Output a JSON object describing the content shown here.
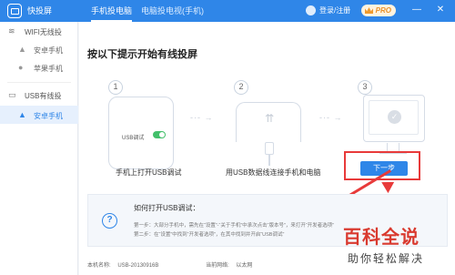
{
  "app": {
    "title": "快投屏"
  },
  "tabs": [
    {
      "label": "手机投电脑",
      "active": true
    },
    {
      "label": "电脑投电视(手机)",
      "active": false
    }
  ],
  "header": {
    "login_label": "登录/注册",
    "pro_label": "PRO",
    "minimize": "—",
    "close": "✕"
  },
  "sidebar": {
    "sections": [
      {
        "label": "WIFI无线投",
        "icon": "wifi-icon",
        "items": [
          {
            "label": "安卓手机",
            "icon": "android-icon"
          },
          {
            "label": "苹果手机",
            "icon": "apple-icon"
          }
        ]
      },
      {
        "label": "USB有线投",
        "icon": "usb-device-icon",
        "items": [
          {
            "label": "安卓手机",
            "icon": "android-icon",
            "active": true
          }
        ]
      }
    ]
  },
  "main": {
    "heading": "按以下提示开始有线投屏",
    "steps": [
      {
        "num": "1",
        "desc": "手机上打开USB调试",
        "toggle_label": "USB调试"
      },
      {
        "num": "2",
        "desc": "用USB数据线连接手机和电脑"
      },
      {
        "num": "3",
        "desc": ""
      }
    ],
    "arrow": "-·- →",
    "next_label": "下一步"
  },
  "help": {
    "title": "如何打开USB调试：",
    "line1": "第一步：大部分手机中，需先在“设置”-“关于手机”中承次点击“版本号”，来打开“开发者选项”",
    "line2": "第二步：在“设置”中找到“开发者选项”，在其中找到并开启“USB调试”"
  },
  "footer": {
    "device_label": "本机名称:",
    "device_value": "USB-20130916B",
    "network_label": "当前网络:",
    "network_value": "以太网"
  },
  "watermark": {
    "title": "百科全说",
    "subtitle": "助你轻松解决"
  },
  "colors": {
    "accent": "#2f86e8",
    "highlight": "#e83a3a",
    "toggle_on": "#43c06b"
  }
}
